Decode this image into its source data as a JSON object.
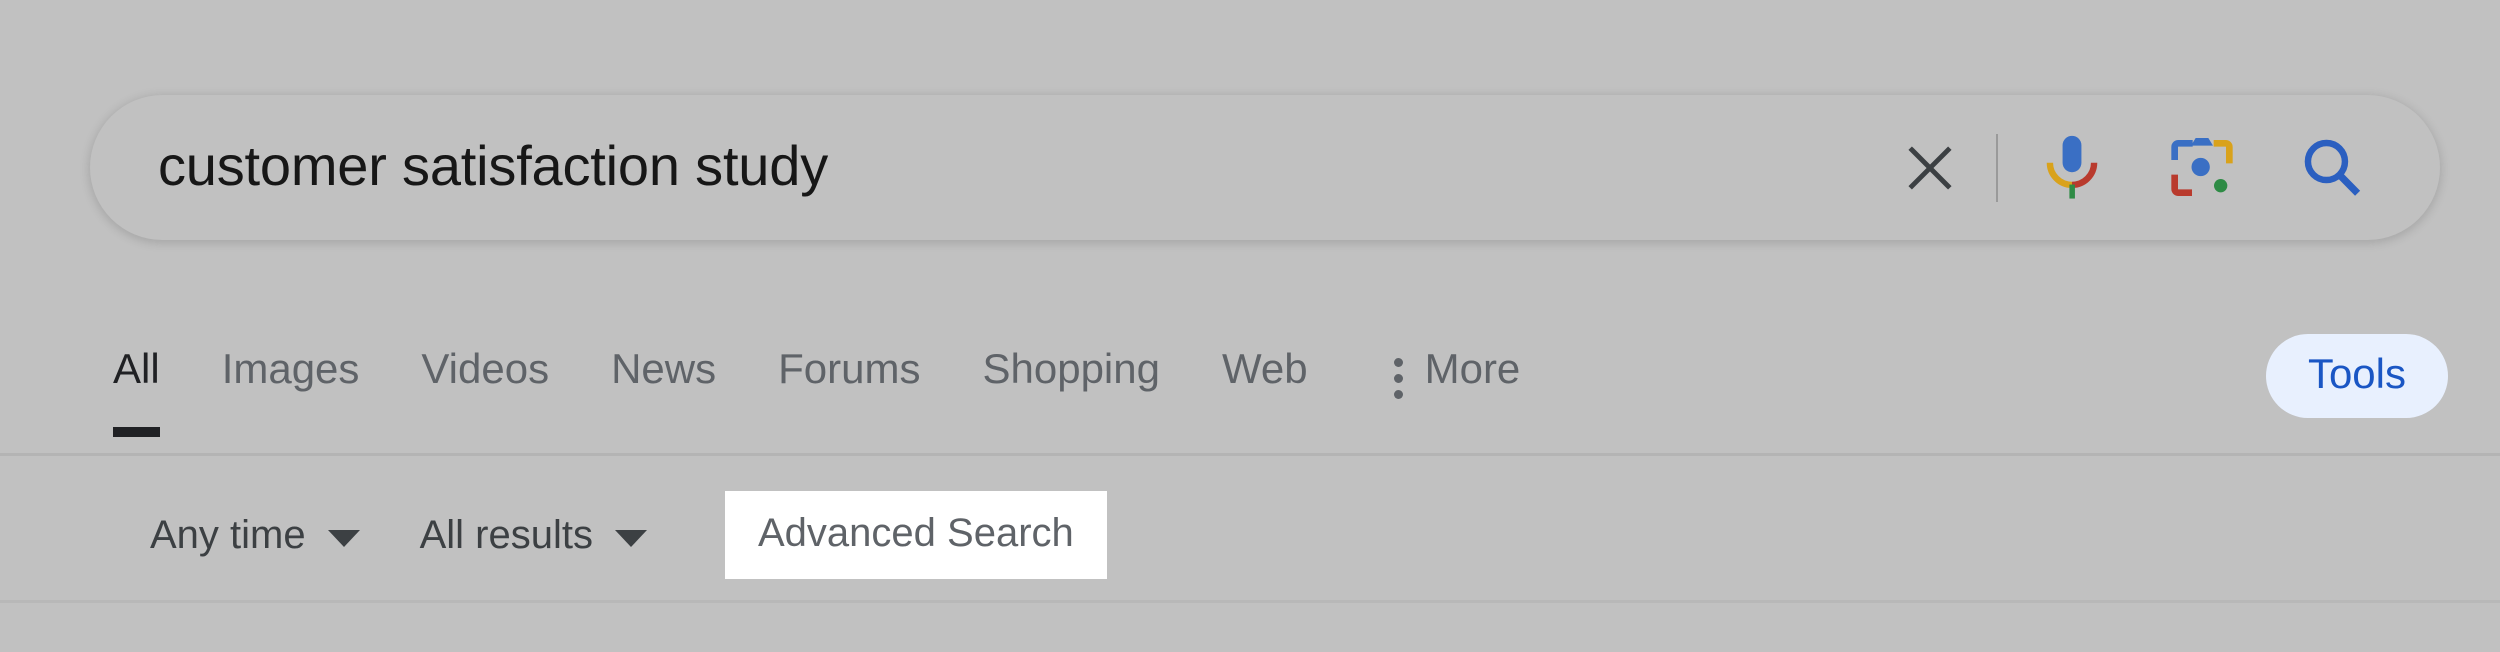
{
  "theme": {
    "page_background": "#c1c1c1",
    "accent_blue": "#1a56c4",
    "tools_pill_background": "#e8f0fe",
    "active_tab_color": "#202124",
    "inactive_tab_color": "#5f6368",
    "advanced_search_background": "#ffffff",
    "google_blue": "#3a6fc4",
    "google_red": "#b93a2d",
    "google_yellow": "#d9a21b",
    "google_green": "#2e8b45"
  },
  "search": {
    "query": "customer satisfaction study",
    "placeholder": "Search",
    "clear_icon": "close-icon",
    "voice_icon": "microphone-icon",
    "lens_icon": "google-lens-icon",
    "search_icon": "search-icon"
  },
  "tabs": [
    {
      "label": "All",
      "active": true
    },
    {
      "label": "Images",
      "active": false
    },
    {
      "label": "Videos",
      "active": false
    },
    {
      "label": "News",
      "active": false
    },
    {
      "label": "Forums",
      "active": false
    },
    {
      "label": "Shopping",
      "active": false
    },
    {
      "label": "Web",
      "active": false
    }
  ],
  "more": {
    "label": "More",
    "icon": "more-vert-icon"
  },
  "tools": {
    "label": "Tools",
    "active": true
  },
  "filters": {
    "time": {
      "label": "Any time",
      "icon": "chevron-down-icon"
    },
    "results": {
      "label": "All results",
      "icon": "chevron-down-icon"
    },
    "advanced_search": {
      "label": "Advanced Search",
      "highlighted": true
    }
  }
}
